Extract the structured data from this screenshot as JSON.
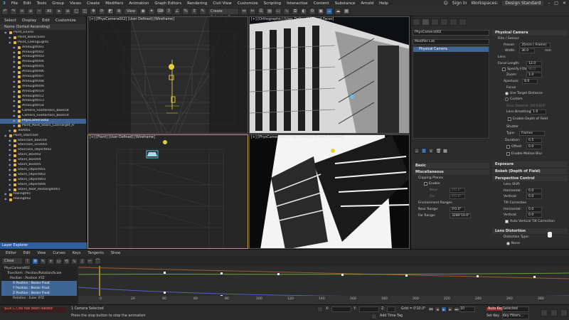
{
  "menu": [
    "File",
    "Edit",
    "Tools",
    "Group",
    "Views",
    "Create",
    "Modifiers",
    "Animation",
    "Graph Editors",
    "Rendering",
    "Civil View",
    "Customize",
    "Scripting",
    "Interactive",
    "Content",
    "Substance",
    "Arnold",
    "Help"
  ],
  "account": {
    "signin": "Sign In",
    "workspaces": "Workspaces:",
    "workspace_value": "Design Standard"
  },
  "toolbar": {
    "filter": "All",
    "view": "View",
    "selection_set": "Create Selection Se"
  },
  "explorer": {
    "menu": [
      "Select",
      "Display",
      "Edit",
      "Customize"
    ],
    "column": "Name (Sorted Ascending)",
    "items": [
      {
        "label": "Point_Enviro",
        "indent": 1
      },
      {
        "label": "Point_Bookcases",
        "indent": 2
      },
      {
        "label": "Point_CeilingLights",
        "indent": 2
      },
      {
        "label": "AreaLight001",
        "indent": 3
      },
      {
        "label": "AreaLight002",
        "indent": 3
      },
      {
        "label": "AreaLight003",
        "indent": 3
      },
      {
        "label": "AreaLight004",
        "indent": 3
      },
      {
        "label": "AreaLight005",
        "indent": 3
      },
      {
        "label": "AreaLight006",
        "indent": 3
      },
      {
        "label": "AreaLight007",
        "indent": 3
      },
      {
        "label": "AreaLight008",
        "indent": 3
      },
      {
        "label": "AreaLight009",
        "indent": 3
      },
      {
        "label": "AreaLight010",
        "indent": 3
      },
      {
        "label": "AreaLight012",
        "indent": 3
      },
      {
        "label": "AreaLight013",
        "indent": 3
      },
      {
        "label": "AreaLight014",
        "indent": 3
      },
      {
        "label": "Camera_Fooltarears_Box018",
        "indent": 3
      },
      {
        "label": "Camera_Fooltarears_Box019",
        "indent": 3
      },
      {
        "label": "PhysCamera002",
        "indent": 3,
        "selected": true
      },
      {
        "label": "Point_Point_Stairs_CamTarget_Fr",
        "indent": 3
      },
      {
        "label": "Text001",
        "indent": 2
      },
      {
        "label": "Point_Staircase",
        "indent": 1
      },
      {
        "label": "Staircase_Box018",
        "indent": 2
      },
      {
        "label": "Staircase_Line001",
        "indent": 2
      },
      {
        "label": "Staircase_Object002",
        "indent": 2
      },
      {
        "label": "Stairs_Box002",
        "indent": 2
      },
      {
        "label": "Stairs_Box004",
        "indent": 2
      },
      {
        "label": "Stairs_Box005",
        "indent": 2
      },
      {
        "label": "Stairs_Object001",
        "indent": 2
      },
      {
        "label": "Stairs_Object002",
        "indent": 2
      },
      {
        "label": "Stairs_Object003",
        "indent": 2
      },
      {
        "label": "Stairs_Object006",
        "indent": 2
      },
      {
        "label": "Stairs_Roof_Rectangle001",
        "indent": 2
      },
      {
        "label": "Railing001",
        "indent": 1
      },
      {
        "label": "Railing002",
        "indent": 1
      }
    ],
    "footer": "Layer Explorer"
  },
  "viewports": [
    {
      "label": "[+] [PhysCamera002] [User Defined] [Wireframe]"
    },
    {
      "label": "[+] [Orthographic] [User Defined] [Edged Faces]"
    },
    {
      "label": "[+] [Front] [User Defined] [Wireframe]"
    },
    {
      "label": "[+] [PhysCamera002] [High Quality] [Default Shading]"
    }
  ],
  "command_panel": {
    "object_name": "PhysCamera002",
    "modifier_list": "Modifier List",
    "stack_item": "Physical Camera",
    "rollouts": {
      "physical_camera": "Physical Camera",
      "film_sensor": "Film / Sensor",
      "preset_label": "Preset:",
      "preset_value": "35mm ( Frame)",
      "width_label": "Width:",
      "width_value": "36.0",
      "width_unit": "mm",
      "lens": "Lens",
      "focal_length_label": "Focal Length:",
      "focal_length_value": "12.0",
      "specify_fov": "Specify FOV:",
      "fov_value": "90.0",
      "zoom_label": "Zoom:",
      "zoom_value": "1.0",
      "aperture_label": "Aperture:",
      "aperture_value": "8.0",
      "focus": "Focus",
      "use_target": "Use Target Distance",
      "custom": "Custom",
      "focus_distance": "Focus Distance: 160'4.834\"",
      "lens_breathing_label": "Lens Breathing:",
      "lens_breathing_value": "1.0",
      "enable_dof": "Enable Depth of Field",
      "shutter": "Shutter",
      "type_label": "Type:",
      "type_value": "frames",
      "duration_label": "Duration:",
      "duration_value": "0.5",
      "offset_label": "Offset:",
      "offset_value": "0.0",
      "motion_blur": "Enable Motion Blur",
      "exposure": "Exposure",
      "bokeh": "Bokeh (Depth of Field)",
      "perspective": "Perspective Control",
      "lens_shift": "Lens Shift",
      "horizontal_label": "Horizontal:",
      "horizontal_value": "0.0",
      "vertical_label": "Vertical:",
      "vertical_value": "0.0",
      "tilt": "Tilt Correction",
      "tilt_h_value": "0.0",
      "tilt_v_value": "0.0",
      "auto_tilt": "Auto Vertical Tilt Correction",
      "lens_distortion": "Lens Distortion",
      "distortion_type": "Distortion Type:",
      "none": "None",
      "basic": "Basic",
      "miscellaneous": "Miscellaneous",
      "clipping_planes": "Clipping Planes",
      "enable": "Enable",
      "near_label": "Near:",
      "near_value": "0'0.0\"",
      "far_label": "Far:",
      "far_value": "0'0.0\"",
      "env_ranges": "Environment Ranges",
      "near_range_label": "Near Range:",
      "near_range_value": "0'0.0\"",
      "far_range_label": "Far Range:",
      "far_range_value": "3280'10.0\""
    }
  },
  "curve_editor": {
    "title": "Curve Editor",
    "menu": [
      "Editor",
      "Edit",
      "View",
      "Curves",
      "Keys",
      "Tangents",
      "Show"
    ],
    "close": "Close",
    "tracks": [
      {
        "label": "PhysCamera002",
        "selected": false
      },
      {
        "label": "Transform : Position/Rotation/Scale",
        "selected": false
      },
      {
        "label": "Position : Position XYZ",
        "selected": false
      },
      {
        "label": "X Position : Bezier Float",
        "selected": true
      },
      {
        "label": "Y Position : Bezier Float",
        "selected": true
      },
      {
        "label": "Z Position : Bezier Float",
        "selected": true
      },
      {
        "label": "Rotation : Euler XYZ",
        "selected": false
      }
    ],
    "ruler": [
      "0",
      "20",
      "40",
      "60",
      "80",
      "100",
      "120",
      "140",
      "160",
      "180",
      "200",
      "220",
      "240",
      "260",
      "280"
    ]
  },
  "status": {
    "script_msg": "\"$LiX C:\\ Bk has been loaded\"",
    "selection": "1 Camera Selected",
    "prompt": "Press the stop button to stop the animation",
    "x_label": "X:",
    "x_value": "",
    "y_label": "Y:",
    "z_label": "Z:",
    "grid": "Grid = 0'10.0\"",
    "add_time_tag": "Add Time Tag",
    "auto_key": "Auto Key",
    "set_key": "Set Key",
    "selected": "Selected",
    "key_filters": "Key Filters...",
    "frame": "10"
  }
}
